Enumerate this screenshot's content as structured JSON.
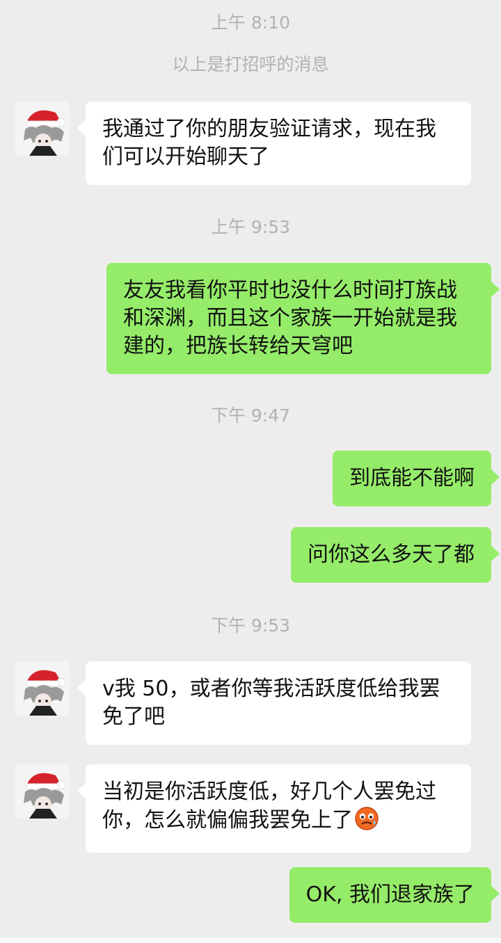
{
  "colors": {
    "background": "#ededed",
    "outgoing_bubble": "#95ec69",
    "incoming_bubble": "#ffffff",
    "timestamp": "#b2b2b2"
  },
  "chat": {
    "ts1": "上午 8:10",
    "system_note": "以上是打招呼的消息",
    "msg1": "我通过了你的朋友验证请求，现在我们可以开始聊天了",
    "ts2": "上午 9:53",
    "msg2": "友友我看你平时也没什么时间打族战和深渊，而且这个家族一开始就是我建的，把族长转给天穹吧",
    "ts3": "下午 9:47",
    "msg3": "到底能不能啊",
    "msg4": "问你这么多天了都",
    "ts4": "下午 9:53",
    "msg5": "v我 50，或者你等我活跃度低给我罢免了吧",
    "msg6": "当初是你活跃度低，好几个人罢免过你，怎么就偏偏我罢免上了",
    "msg6_emoji": "angry-sweat-emoji",
    "msg7": "OK, 我们退家族了"
  }
}
